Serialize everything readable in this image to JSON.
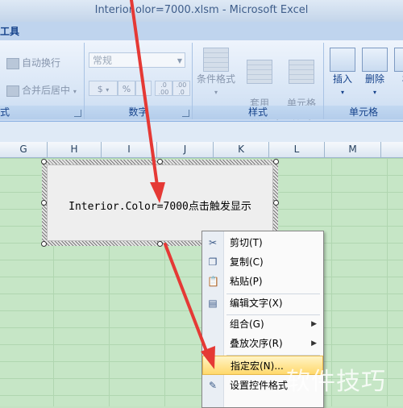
{
  "window": {
    "title": "Interior.olor=7000.xlsm - Microsoft Excel"
  },
  "tabs": {
    "current_partial": "工具"
  },
  "ribbon": {
    "alignment": {
      "wrap_text": "自动换行",
      "merge_center": "合并后居中"
    },
    "number": {
      "format_value": "常规",
      "percent": "%",
      "comma": ",",
      "inc_decimal": ".0 .00",
      "dec_decimal": ".00 .0",
      "currency": "$",
      "group_label": "数字"
    },
    "styles": {
      "conditional": "条件格式",
      "table_format": "套用\n表格格式",
      "cell_styles": "单元格\n样式",
      "group_label": "样式"
    },
    "cells": {
      "insert": "插入",
      "delete": "删除",
      "group_label": "单元格"
    },
    "left_group_label": "式"
  },
  "columns": [
    "G",
    "H",
    "I",
    "J",
    "K",
    "L",
    "M"
  ],
  "shape": {
    "caption": "Interior.Color=7000点击触发显示"
  },
  "context_menu": {
    "items": [
      {
        "label": "剪切(T)",
        "icon": "scissors-icon"
      },
      {
        "label": "复制(C)",
        "icon": "copy-icon"
      },
      {
        "label": "粘贴(P)",
        "icon": "paste-icon"
      },
      {
        "label": "编辑文字(X)",
        "icon": "edit-text-icon"
      },
      {
        "label": "组合(G)",
        "icon": "",
        "submenu": true
      },
      {
        "label": "叠放次序(R)",
        "icon": "",
        "submenu": true
      },
      {
        "label": "指定宏(N)...",
        "icon": "",
        "highlight": true
      },
      {
        "label": "设置控件格式",
        "icon": "format-control-icon"
      }
    ]
  },
  "watermark": "软件技巧",
  "colors": {
    "sheet_bg": "#c6e6c6",
    "arrow": "#e53935",
    "highlight": "#ffd86b"
  }
}
